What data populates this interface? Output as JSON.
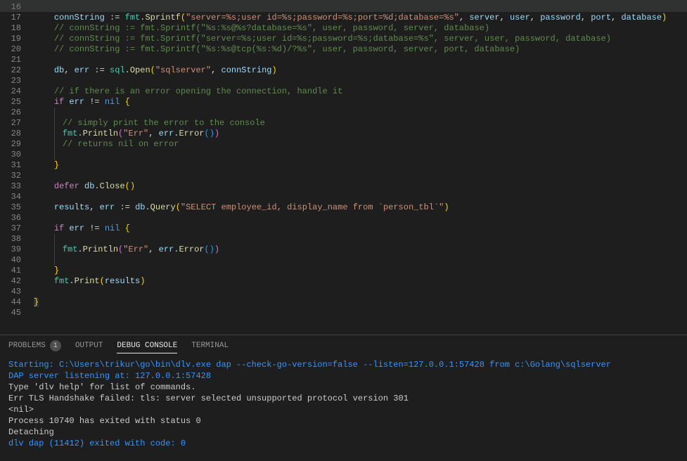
{
  "lineNumbers": [
    "16",
    "17",
    "18",
    "19",
    "20",
    "21",
    "22",
    "23",
    "24",
    "25",
    "26",
    "27",
    "28",
    "29",
    "30",
    "31",
    "32",
    "33",
    "34",
    "35",
    "36",
    "37",
    "38",
    "39",
    "40",
    "41",
    "42",
    "43",
    "44",
    "45"
  ],
  "code": {
    "l17": {
      "v1": "connString",
      "op": ":=",
      "pkg": "fmt",
      "dot1": ".",
      "fn": "Sprintf",
      "p1": "(",
      "s1": "\"server=%s;user id=%s;password=%s;port=%d;database=%s\"",
      "c1": ", ",
      "a1": "server",
      "c2": ", ",
      "a2": "user",
      "c3": ", ",
      "a3": "password",
      "c4": ", ",
      "a4": "port",
      "c5": ", ",
      "a5": "database",
      "p2": ")"
    },
    "l18": "// connString := fmt.Sprintf(\"%s:%s@%s?database=%s\", user, password, server, database)",
    "l19": "// connString := fmt.Sprintf(\"server=%s;user id=%s;password=%s;database=%s\", server, user, password, database)",
    "l20": "// connString := fmt.Sprintf(\"%s:%s@tcp(%s:%d)/?%s\", user, password, server, port, database)",
    "l22": {
      "v1": "db",
      "c1": ", ",
      "v2": "err",
      "op": " := ",
      "pkg": "sql",
      "dot1": ".",
      "fn": "Open",
      "p1": "(",
      "s1": "\"sqlserver\"",
      "c2": ", ",
      "a1": "connString",
      "p2": ")"
    },
    "l24": "// if there is an error opening the connection, handle it",
    "l25": {
      "k1": "if",
      "sp": " ",
      "v1": "err",
      "op": " != ",
      "n1": "nil",
      "sp2": " ",
      "b1": "{"
    },
    "l27": "// simply print the error to the console",
    "l28": {
      "pkg": "fmt",
      "dot1": ".",
      "fn": "Println",
      "p1": "(",
      "s1": "\"Err\"",
      "c1": ", ",
      "a1": "err",
      "dot2": ".",
      "fn2": "Error",
      "p2": "(",
      ")": ")",
      "p3": ")"
    },
    "l29": "// returns nil on error",
    "l31": "}",
    "l33": {
      "k1": "defer",
      "sp": " ",
      "v1": "db",
      "dot1": ".",
      "fn": "Close",
      "p1": "(",
      "p2": ")"
    },
    "l35": {
      "v1": "results",
      "c1": ", ",
      "v2": "err",
      "op": " := ",
      "a1": "db",
      "dot1": ".",
      "fn": "Query",
      "p1": "(",
      "s1": "\"SELECT employee_id, display_name from `person_tbl`\"",
      "p2": ")"
    },
    "l37": {
      "k1": "if",
      "sp": " ",
      "v1": "err",
      "op": " != ",
      "n1": "nil",
      "sp2": " ",
      "b1": "{"
    },
    "l39": {
      "pkg": "fmt",
      "dot1": ".",
      "fn": "Println",
      "p1": "(",
      "s1": "\"Err\"",
      "c1": ", ",
      "a1": "err",
      "dot2": ".",
      "fn2": "Error",
      "p2": "(",
      ")": ")",
      "p3": ")"
    },
    "l41": "}",
    "l42": {
      "pkg": "fmt",
      "dot1": ".",
      "fn": "Print",
      "p1": "(",
      "a1": "results",
      "p2": ")"
    },
    "l44": "}"
  },
  "panel": {
    "tabs": {
      "problems": "PROBLEMS",
      "problemsCount": "1",
      "output": "OUTPUT",
      "debugConsole": "DEBUG CONSOLE",
      "terminal": "TERMINAL"
    },
    "console": {
      "l1": "Starting: C:\\Users\\trikur\\go\\bin\\dlv.exe dap --check-go-version=false --listen=127.0.0.1:57428 from c:\\Golang\\sqlserver",
      "l2": "DAP server listening at: 127.0.0.1:57428",
      "l3": "Type 'dlv help' for list of commands.",
      "l4": "Err TLS Handshake failed: tls: server selected unsupported protocol version 301",
      "l5": "<nil>",
      "l6": "Process 10740 has exited with status 0",
      "l7": "Detaching",
      "l8": "dlv dap (11412) exited with code: 0"
    }
  }
}
